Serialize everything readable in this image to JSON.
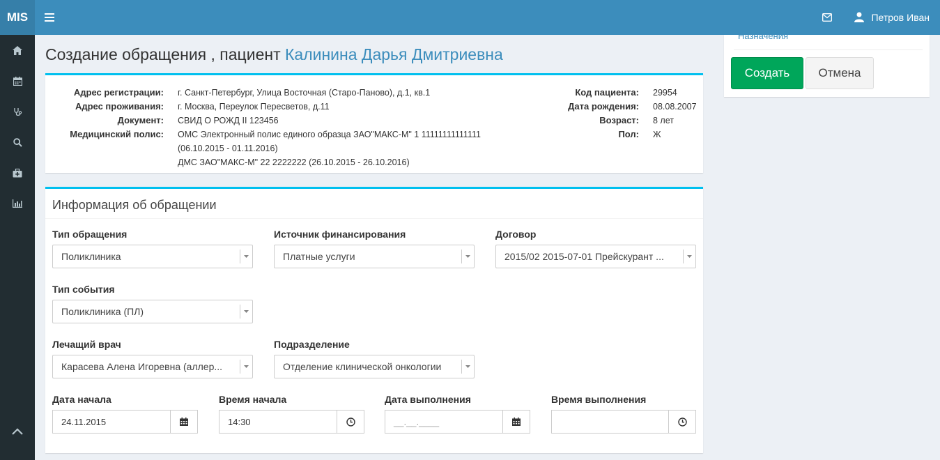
{
  "app": {
    "logo": "MIS"
  },
  "header": {
    "user_name": "Петров Иван",
    "icons": {
      "menu": "hamburger-icon",
      "mail": "envelope-icon",
      "user": "user-icon"
    }
  },
  "sidebar": {
    "items": [
      {
        "icon": "home-icon"
      },
      {
        "icon": "calendar-icon"
      },
      {
        "icon": "stethoscope-icon"
      },
      {
        "icon": "search-icon"
      },
      {
        "icon": "medkit-icon"
      },
      {
        "icon": "bar-chart-icon"
      }
    ],
    "bottom_icon": "chevron-up-icon"
  },
  "page": {
    "title_prefix": "Создание обращения , пациент",
    "patient_name": "Калинина Дарья Дмитриевна"
  },
  "patient_card": {
    "labels": {
      "address_reg": "Адрес регистрации:",
      "address_live": "Адрес проживания:",
      "document": "Документ:",
      "policy": "Медицинский полис:",
      "patient_code": "Код пациента:",
      "birth_date": "Дата рождения:",
      "age": "Возраст:",
      "sex": "Пол:"
    },
    "values": {
      "address_reg": "г. Санкт-Петербург, Улица Восточная (Старо-Паново), д.1, кв.1",
      "address_live": "г. Москва, Переулок Пересветов, д.11",
      "document": "СВИД О РОЖД II 123456",
      "policy_line1": "ОМС Электронный полис единого образца ЗАО\"МАКС-М\" 1 11111111111111",
      "policy_line2": "(06.10.2015 - 01.11.2016)",
      "policy_line3": "ДМС ЗАО\"МАКС-М\" 22 2222222 (26.10.2015 - 26.10.2016)",
      "patient_code": "29954",
      "birth_date": "08.08.2007",
      "age": "8 лет",
      "sex": "Ж"
    }
  },
  "form": {
    "title": "Информация об обращении",
    "fields": {
      "appeal_type": {
        "label": "Тип обращения",
        "value": "Поликлиника"
      },
      "funding_source": {
        "label": "Источник финансирования",
        "value": "Платные услуги"
      },
      "contract": {
        "label": "Договор",
        "value": "2015/02 2015-07-01 Прейскурант ..."
      },
      "event_type": {
        "label": "Тип события",
        "value": "Поликлиника (ПЛ)"
      },
      "doctor": {
        "label": "Лечащий врач",
        "value": "Карасева Алена Игоревна (аллер..."
      },
      "department": {
        "label": "Подразделение",
        "value": "Отделение клинической онкологии"
      },
      "start_date": {
        "label": "Дата начала",
        "value": "24.11.2015"
      },
      "start_time": {
        "label": "Время начала",
        "value": "14:30"
      },
      "exec_date": {
        "label": "Дата выполнения",
        "placeholder": "__.__.____"
      },
      "exec_time": {
        "label": "Время выполнения",
        "value": ""
      }
    }
  },
  "right_panel": {
    "link": "Назначения",
    "create_label": "Создать",
    "cancel_label": "Отмена"
  },
  "colors": {
    "brand": "#3c8dbc",
    "sidebar": "#222d32",
    "accent_border": "#00c0ef",
    "create": "#00a65a"
  }
}
